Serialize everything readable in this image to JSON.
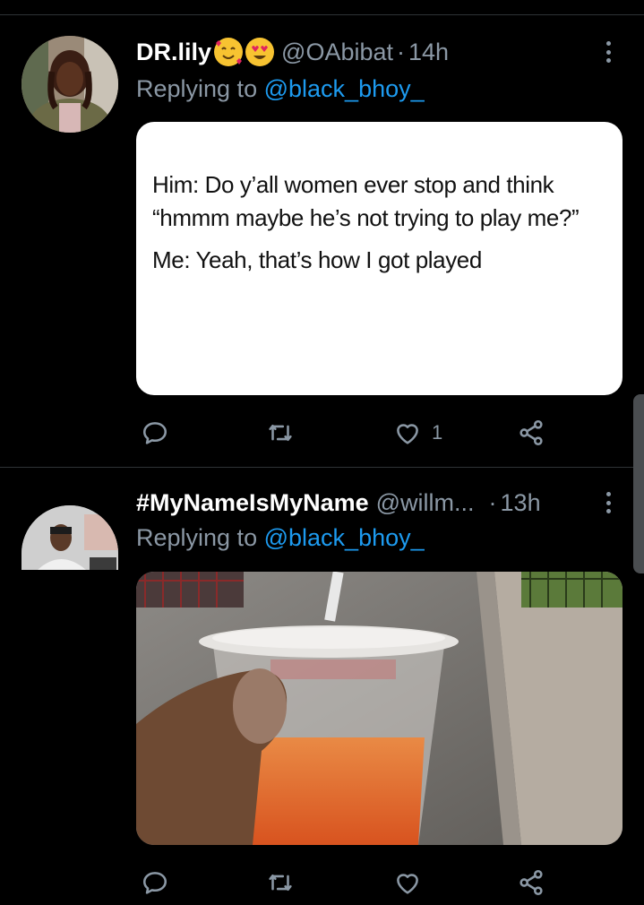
{
  "tweets": [
    {
      "name": "DR.lily",
      "name_emojis": [
        "smiling-face-with-hearts",
        "heart-eyes"
      ],
      "handle": "@OAbibat",
      "time": "14h",
      "replying_prefix": "Replying to",
      "replying_to": "@black_bhoy_",
      "media_text": [
        "Him: Do y’all women ever stop and think “hmmm maybe he’s not trying to play me?”",
        "Me:  Yeah, that’s how I got played"
      ],
      "reply_count": "",
      "retweet_count": "",
      "like_count": "1"
    },
    {
      "name": "#MyNameIsMyName",
      "handle": "@willm...",
      "time": "13h",
      "replying_prefix": "Replying to",
      "replying_to": "@black_bhoy_",
      "media_alt": "photo of a hand holding a cup of orange juice",
      "reply_count": "",
      "retweet_count": "",
      "like_count": ""
    }
  ],
  "colors": {
    "background": "#000000",
    "secondary_text": "#8b98a5",
    "link": "#1d9bf0",
    "divider": "#2f3336"
  },
  "icons": [
    "reply-icon",
    "retweet-icon",
    "like-icon",
    "share-icon",
    "more-options-icon"
  ]
}
